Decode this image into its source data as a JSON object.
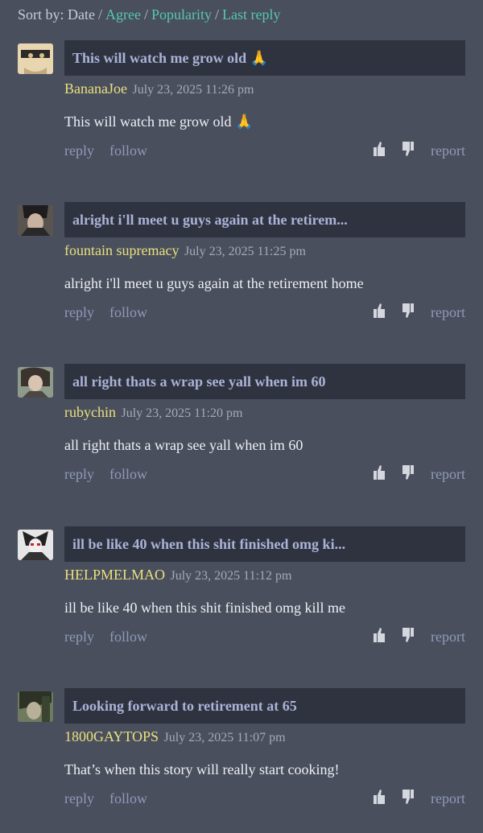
{
  "sort": {
    "prefix": "Sort by: Date",
    "options": [
      "Agree",
      "Popularity",
      "Last reply"
    ]
  },
  "actions": {
    "reply": "reply",
    "follow": "follow",
    "report": "report"
  },
  "comments": [
    {
      "title": "This will watch me grow old",
      "title_emoji": "🙏",
      "user": "BananaJoe",
      "date": "July 23, 2025 11:26 pm",
      "body": "This will watch me grow old",
      "body_emoji": "🙏"
    },
    {
      "title": "alright i'll meet u guys again at the retirem...",
      "title_emoji": "",
      "user": "fountain supremacy",
      "date": "July 23, 2025 11:25 pm",
      "body": "alright i'll meet u guys again at the retirement home",
      "body_emoji": ""
    },
    {
      "title": "all right thats a wrap see yall when im 60",
      "title_emoji": "",
      "user": "rubychin",
      "date": "July 23, 2025 11:20 pm",
      "body": "all right thats a wrap see yall when im 60",
      "body_emoji": ""
    },
    {
      "title": "ill be like 40 when this shit finished omg ki...",
      "title_emoji": "",
      "user": "HELPMELMAO",
      "date": "July 23, 2025 11:12 pm",
      "body": "ill be like 40 when this shit finished omg kill me",
      "body_emoji": ""
    },
    {
      "title": "Looking forward to retirement at 65",
      "title_emoji": "",
      "user": "1800GAYTOPS",
      "date": "July 23, 2025 11:07 pm",
      "body": "That’s when this story will really start cooking!",
      "body_emoji": ""
    }
  ]
}
